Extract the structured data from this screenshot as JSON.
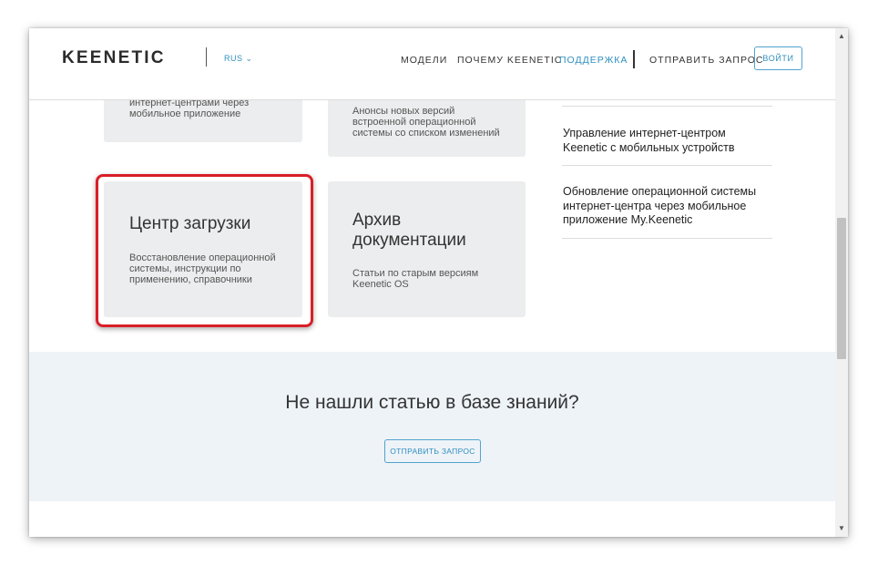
{
  "header": {
    "logo": "KEENETIC",
    "lang": "RUS",
    "nav": [
      "МОДЕЛИ",
      "ПОЧЕМУ KEENETIC",
      "ПОДДЕРЖКА",
      "ОТПРАВИТЬ ЗАПРОС"
    ],
    "active_nav": "ПОДДЕРЖКА",
    "login_label": "ВОЙТИ"
  },
  "cards": {
    "top_left_text": [
      "интернет-центрами через",
      "мобильное приложение"
    ],
    "top_mid_text": [
      "Анонсы новых версий",
      "встроенной операционной",
      "системы со списком изменений"
    ],
    "download_center": {
      "title": "Центр загрузки",
      "desc": [
        "Восстановление операционной",
        "системы, инструкции по",
        "применению, справочники"
      ]
    },
    "archive": {
      "title": [
        "Архив",
        "документации"
      ],
      "desc": [
        "Статьи по старым версиям",
        "Keenetic OS"
      ]
    }
  },
  "articles": [
    [
      "Управление интернет-центром",
      "Keenetic с мобильных устройств"
    ],
    [
      "Обновление операционной системы",
      "интернет-центра через мобильное",
      "приложение My.Keenetic"
    ]
  ],
  "band": {
    "title": "Не нашли статью в базе знаний?",
    "button": "ОТПРАВИТЬ ЗАПРОС"
  },
  "colors": {
    "accent": "#2f8fbf",
    "highlight": "#d91e27",
    "card_bg": "#ecedee",
    "band_bg": "#eef3f8"
  }
}
